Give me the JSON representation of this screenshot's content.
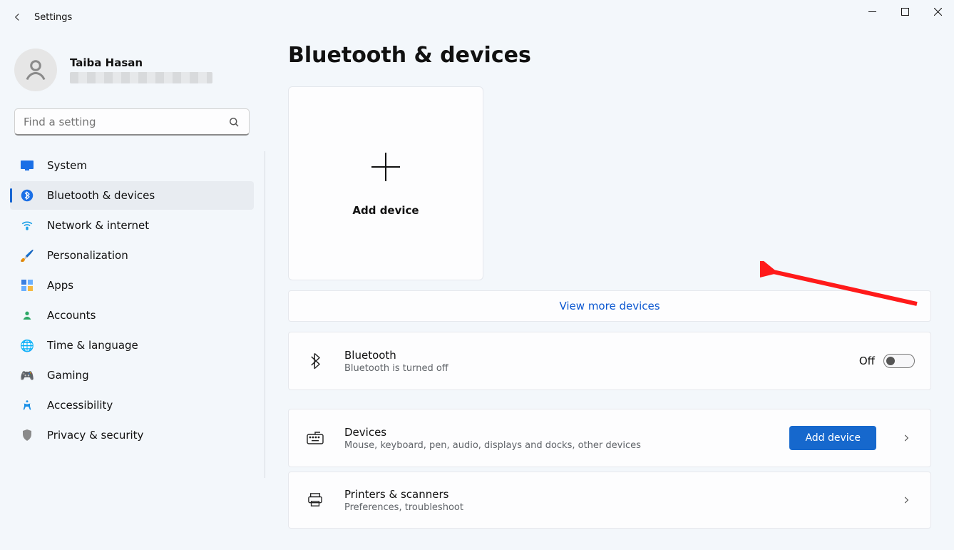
{
  "app": {
    "title": "Settings"
  },
  "profile": {
    "name": "Taiba Hasan"
  },
  "search": {
    "placeholder": "Find a setting"
  },
  "sidebar": {
    "items": [
      {
        "label": "System",
        "icon": "monitor-icon"
      },
      {
        "label": "Bluetooth & devices",
        "icon": "bluetooth-icon",
        "active": true
      },
      {
        "label": "Network & internet",
        "icon": "wifi-icon"
      },
      {
        "label": "Personalization",
        "icon": "brush-icon"
      },
      {
        "label": "Apps",
        "icon": "apps-icon"
      },
      {
        "label": "Accounts",
        "icon": "person-icon"
      },
      {
        "label": "Time & language",
        "icon": "globe-clock-icon"
      },
      {
        "label": "Gaming",
        "icon": "gamepad-icon"
      },
      {
        "label": "Accessibility",
        "icon": "accessibility-icon"
      },
      {
        "label": "Privacy & security",
        "icon": "shield-icon"
      }
    ]
  },
  "page": {
    "title": "Bluetooth & devices",
    "add_tile": {
      "label": "Add device"
    },
    "view_more": "View more devices",
    "bluetooth_row": {
      "title": "Bluetooth",
      "subtitle": "Bluetooth is turned off",
      "toggle_label": "Off"
    },
    "devices_row": {
      "title": "Devices",
      "subtitle": "Mouse, keyboard, pen, audio, displays and docks, other devices",
      "button": "Add device"
    },
    "printers_row": {
      "title": "Printers & scanners",
      "subtitle": "Preferences, troubleshoot"
    }
  }
}
